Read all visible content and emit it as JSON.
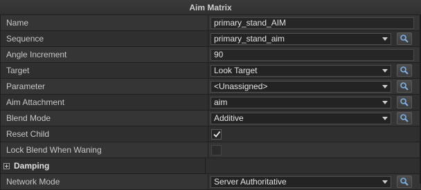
{
  "panel": {
    "title": "Aim Matrix"
  },
  "rows": {
    "name": {
      "label": "Name",
      "value": "primary_stand_AIM"
    },
    "sequence": {
      "label": "Sequence",
      "value": "primary_stand_aim"
    },
    "angle_increment": {
      "label": "Angle Increment",
      "value": "90"
    },
    "target": {
      "label": "Target",
      "value": "Look Target"
    },
    "parameter": {
      "label": "Parameter",
      "value": "<Unassigned>"
    },
    "aim_attachment": {
      "label": "Aim Attachment",
      "value": "aim"
    },
    "blend_mode": {
      "label": "Blend Mode",
      "value": "Additive"
    },
    "reset_child": {
      "label": "Reset Child",
      "checked": true
    },
    "lock_blend": {
      "label": "Lock Blend When Waning",
      "checked": false
    },
    "damping": {
      "label": "Damping",
      "expander": "plus"
    },
    "network_mode": {
      "label": "Network Mode",
      "value": "Server Authoritative"
    }
  },
  "icons": {
    "picker": "magnifier-picker-icon",
    "dropdown": "chevron-down-icon",
    "check": "checkmark-icon"
  },
  "colors": {
    "background": "#2b2b2b",
    "row_odd": "#353535",
    "row_even": "#2f2f2f",
    "icon_blue": "#6aa6e6"
  }
}
